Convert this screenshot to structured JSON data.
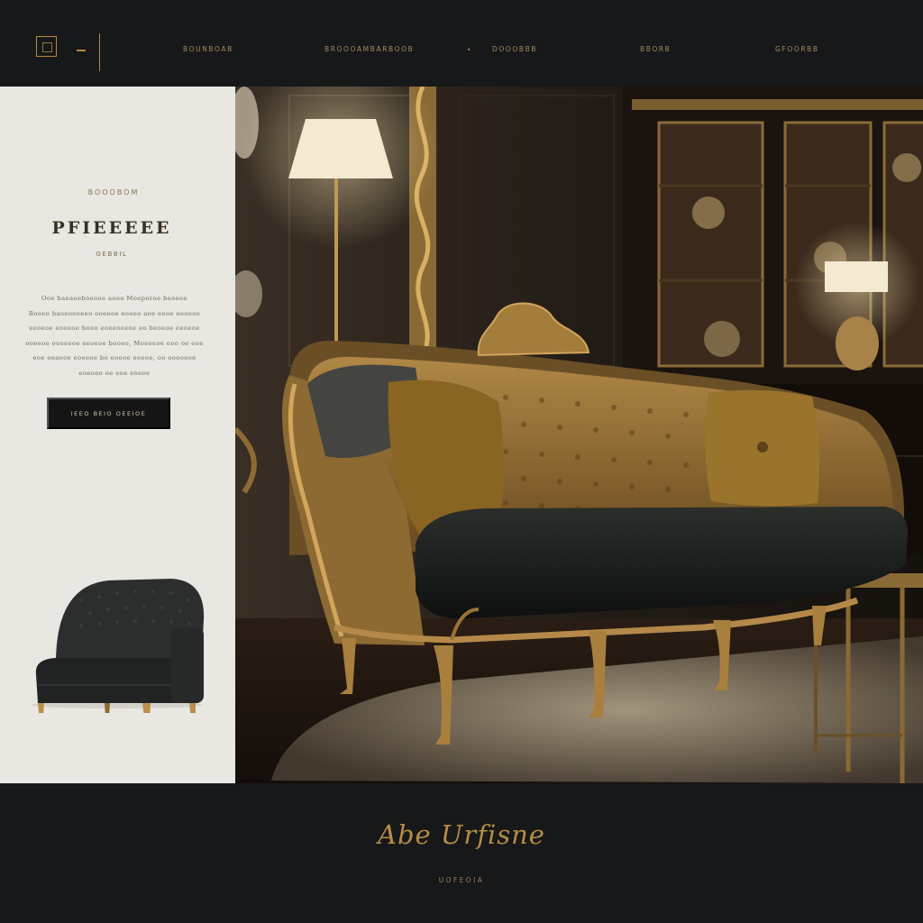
{
  "header": {
    "logo_icon": "square-monogram-icon",
    "nav": [
      {
        "label": "BOUNBOAB"
      },
      {
        "label": "BROOOAMBARBOOB"
      },
      {
        "label": "DOOOBBB"
      },
      {
        "label": "BBORB"
      },
      {
        "label": "GFOORBB"
      }
    ],
    "separator": "•"
  },
  "hero_panel": {
    "eyebrow": "BOOOBOM",
    "title": "PFIEEEEE",
    "subtitle": "GEBBIL",
    "paragraph": [
      "Ooe baeaoeboeooe aoeo Moeporoe beoeoe",
      "Booeo baoeoeoeeo ooeeoe eoeeo aoe eeoe eeoeoe",
      "eeoeoe eoeeoe boeo eoeeoeeoe eo beoeoe eeoeoe",
      "eoeeoe oeoeeoe eeoeoe beoeo, Moeoeoe eeo oe eoe",
      "eoe oeaeoe eoeeoe bo eoeoe eoeoe, oo eoeoeoe",
      "eoeoeo oe eoe eoeoe"
    ],
    "cta_label": "IEEO BEIO OEEIOE"
  },
  "footer": {
    "signature": "Abe Urfisne",
    "caption": "UOFEOIA"
  },
  "colors": {
    "accent_gold": "#b8893e",
    "dark_bg": "#161819",
    "panel_bg": "#e9e7e2"
  }
}
